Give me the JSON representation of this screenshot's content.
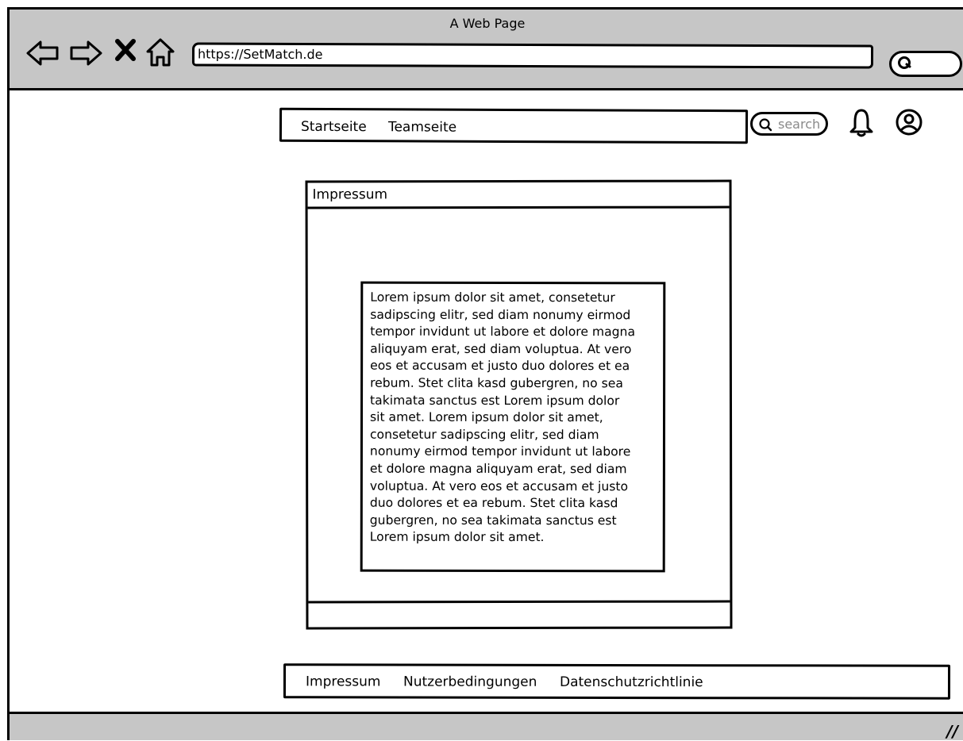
{
  "browser": {
    "window_title": "A Web Page",
    "url": "https://SetMatch.de",
    "icons": [
      "back-arrow-icon",
      "forward-arrow-icon",
      "close-x-icon",
      "home-icon",
      "search-icon"
    ]
  },
  "header": {
    "nav": [
      {
        "label": "Startseite"
      },
      {
        "label": "Teamseite"
      }
    ],
    "search_placeholder": "search",
    "icons": [
      "search-icon",
      "bell-icon",
      "user-account-icon"
    ]
  },
  "main": {
    "panel_title": "Impressum",
    "body_text": "Lorem ipsum dolor sit amet, consetetur\nsadipscing elitr, sed diam nonumy eirmod\ntempor invidunt ut labore et dolore magna\naliquyam erat, sed diam voluptua. At vero\neos et accusam et justo duo dolores et ea\nrebum. Stet clita kasd gubergren, no sea\ntakimata sanctus est Lorem ipsum dolor\nsit amet. Lorem ipsum dolor sit amet,\nconsetetur sadipscing elitr, sed diam\nnonumy eirmod tempor invidunt ut labore\net dolore magna aliquyam erat, sed diam\nvoluptua. At vero eos et accusam et justo\nduo dolores et ea rebum. Stet clita kasd\ngubergren, no sea takimata sanctus est\nLorem ipsum dolor sit amet."
  },
  "footer": {
    "links": [
      {
        "label": "Impressum"
      },
      {
        "label": "Nutzerbedingungen"
      },
      {
        "label": "Datenschutzrichtlinie"
      }
    ]
  },
  "statusbar": {
    "resize_glyph": "//"
  },
  "colors": {
    "chrome_gray": "#c6c6c6",
    "stroke": "#000000",
    "placeholder_gray": "#8a8a8a"
  }
}
